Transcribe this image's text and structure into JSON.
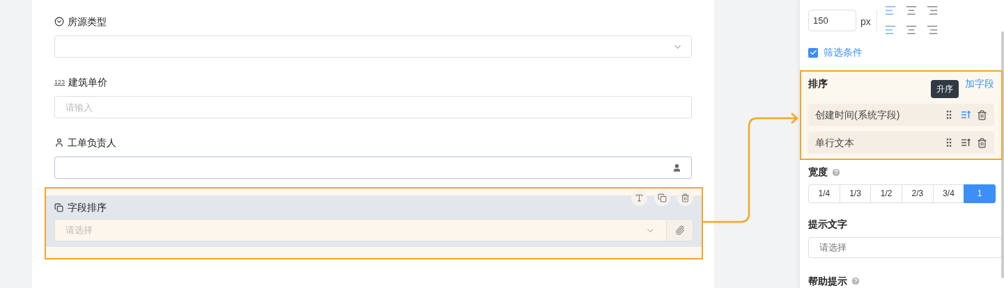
{
  "form_fields": [
    {
      "label": "房源类型",
      "kind": "select"
    },
    {
      "label": "建筑单价",
      "kind": "number",
      "badge": "123",
      "placeholder": "请输入"
    },
    {
      "label": "工单负责人",
      "kind": "user"
    }
  ],
  "selected_field": {
    "label": "字段排序",
    "placeholder": "请选择"
  },
  "panel": {
    "width_input": {
      "value": "150",
      "unit": "px"
    },
    "align_groups": [
      {
        "options": [
          {
            "kind": "left",
            "selected": true
          },
          {
            "kind": "center",
            "selected": false
          },
          {
            "kind": "right",
            "selected": false
          }
        ]
      },
      {
        "options": [
          {
            "kind": "left",
            "selected": true
          },
          {
            "kind": "center",
            "selected": false
          },
          {
            "kind": "right",
            "selected": false
          }
        ]
      }
    ],
    "filter_checkbox": {
      "label": "筛选条件",
      "checked": true
    },
    "sort": {
      "title": "排序",
      "add_link": "加字段",
      "tooltip": "升序",
      "rows": [
        {
          "label": "创建时间(系统字段)",
          "selected": true
        },
        {
          "label": "单行文本",
          "selected": false
        }
      ]
    },
    "width": {
      "label": "宽度",
      "options": [
        {
          "label": "1/4",
          "selected": false
        },
        {
          "label": "1/3",
          "selected": false
        },
        {
          "label": "1/2",
          "selected": false
        },
        {
          "label": "2/3",
          "selected": false
        },
        {
          "label": "3/4",
          "selected": false
        },
        {
          "label": "1",
          "selected": true
        }
      ]
    },
    "hint_text": {
      "label": "提示文字",
      "placeholder": "请选择"
    },
    "help": {
      "label": "帮助提示"
    }
  }
}
